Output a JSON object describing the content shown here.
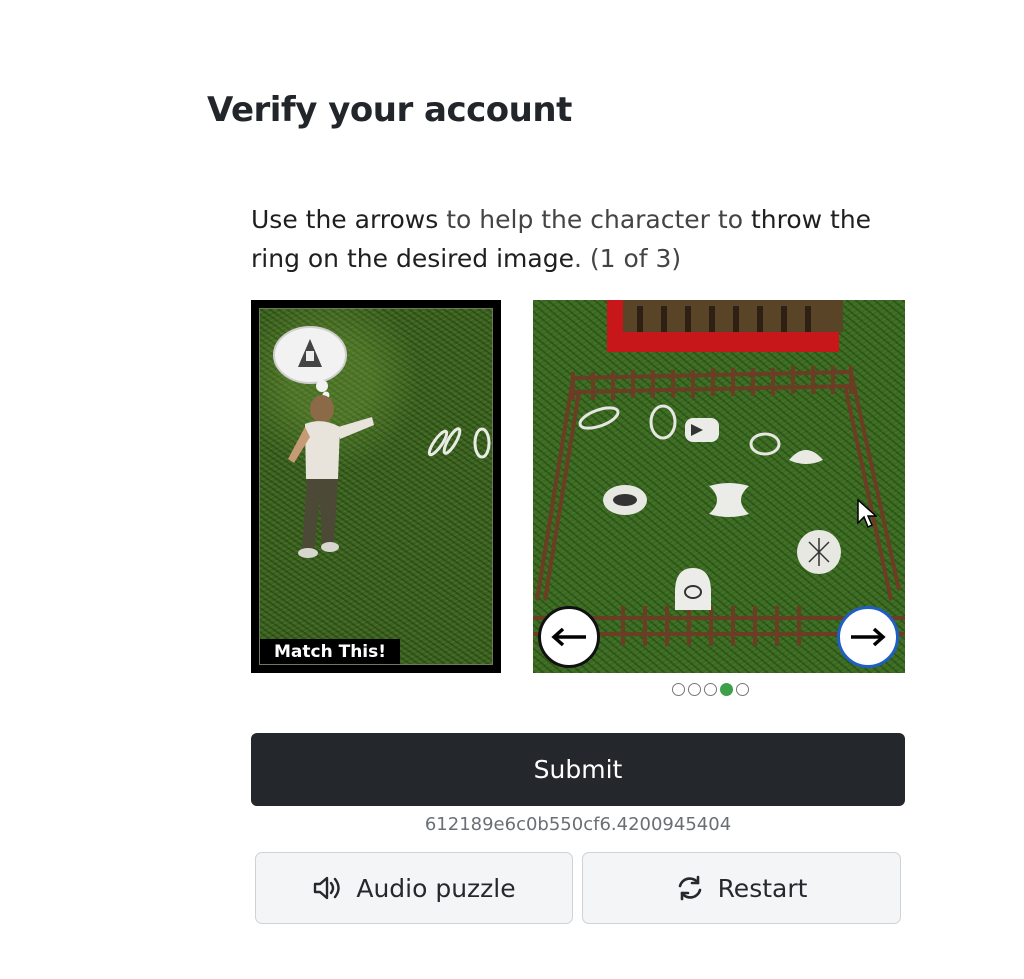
{
  "page": {
    "title": "Verify your account"
  },
  "instructions": {
    "part1": "Use the arrows",
    "part2": " to help the character to ",
    "part3": "throw the ring on the desired image",
    "part4": ". (1 of 3)"
  },
  "match_panel": {
    "label": "Match This!"
  },
  "carousel": {
    "prev_icon": "arrow-left-icon",
    "next_icon": "arrow-right-icon",
    "dot_count": 5,
    "active_dot_index": 3
  },
  "actions": {
    "submit_label": "Submit",
    "session_id": "612189e6c0b550cf6.4200945404",
    "audio_label": "Audio puzzle",
    "audio_icon": "speaker-icon",
    "restart_label": "Restart",
    "restart_icon": "refresh-icon"
  },
  "colors": {
    "submit_bg": "#24272c",
    "active_dot": "#3e9f4a",
    "next_button_ring": "#1f5fc2"
  }
}
